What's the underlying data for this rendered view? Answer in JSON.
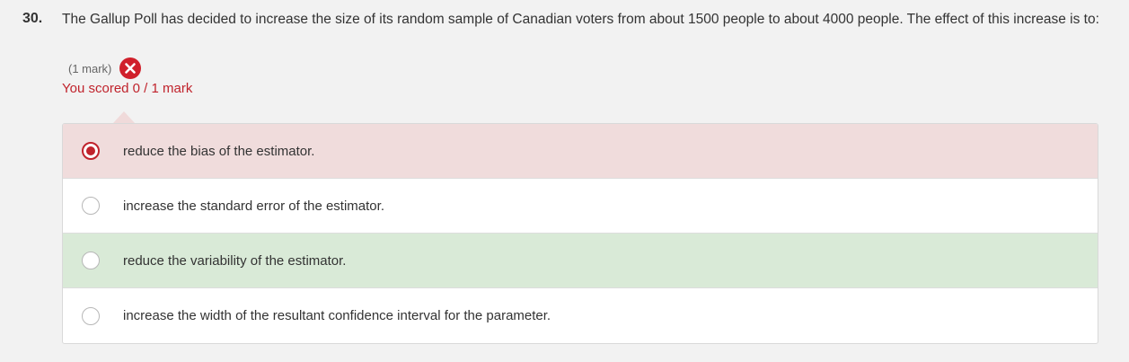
{
  "question": {
    "number": "30.",
    "text": "The Gallup Poll has decided to increase the size of its random sample of Canadian voters from about 1500 people to about 4000 people. The effect of this increase is to:",
    "mark_label": "(1 mark)",
    "result_icon": "wrong-icon",
    "score_text": "You scored 0 / 1 mark"
  },
  "colors": {
    "error": "#c0232c",
    "incorrect_bg": "#f0dcdc",
    "correct_bg": "#d9ead7"
  },
  "options": [
    {
      "label": "reduce the bias of the estimator.",
      "selected": true,
      "state": "incorrect"
    },
    {
      "label": "increase the standard error of the estimator.",
      "selected": false,
      "state": "neutral"
    },
    {
      "label": "reduce the variability of the estimator.",
      "selected": false,
      "state": "correct"
    },
    {
      "label": "increase the width of the resultant confidence interval for the parameter.",
      "selected": false,
      "state": "neutral"
    }
  ]
}
